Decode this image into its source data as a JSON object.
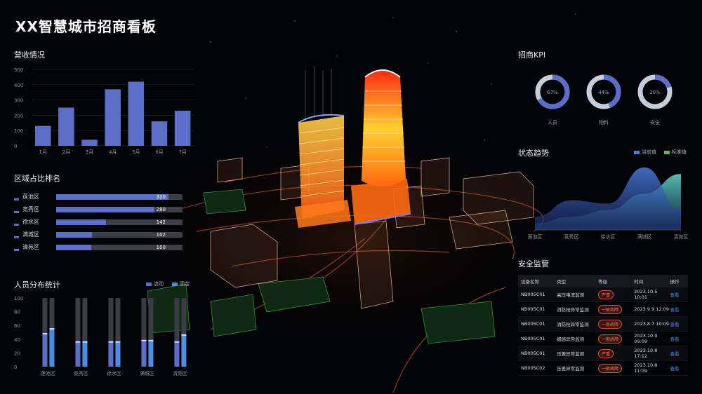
{
  "title": "XX智慧城市招商看板",
  "revenue": {
    "title": "营收情况",
    "yticks": [
      "500",
      "400",
      "300",
      "200",
      "100",
      "0"
    ],
    "chart_data": {
      "type": "bar",
      "categories": [
        "1月",
        "2月",
        "3月",
        "4月",
        "5月",
        "6月",
        "7月"
      ],
      "values": [
        130,
        250,
        40,
        370,
        420,
        160,
        230
      ],
      "ylim": [
        0,
        500
      ],
      "color": "#5b6ec9"
    }
  },
  "district_rank": {
    "title": "区域占比排名",
    "max": 360,
    "items": [
      {
        "name": "莲池区",
        "value": "320",
        "num": 320
      },
      {
        "name": "竞秀区",
        "value": "280",
        "num": 280
      },
      {
        "name": "徐水区",
        "value": "142",
        "num": 142
      },
      {
        "name": "满城区",
        "value": "102",
        "num": 102
      },
      {
        "name": "清苑区",
        "value": "100",
        "num": 100
      }
    ]
  },
  "staff": {
    "title": "人员分布统计",
    "legend": [
      "流动",
      "固定"
    ],
    "yticks": [
      "100",
      "80",
      "60",
      "40",
      "20",
      "0"
    ],
    "chart_data": {
      "type": "bar",
      "categories": [
        "莲池区",
        "竞秀区",
        "徐水区",
        "满城区",
        "清苑区"
      ],
      "series": [
        {
          "name": "流动",
          "values": [
            48,
            36,
            36,
            38,
            36
          ]
        },
        {
          "name": "固定",
          "values": [
            55,
            36,
            36,
            38,
            46
          ]
        }
      ],
      "ylim": [
        0,
        100
      ]
    }
  },
  "kpi": {
    "title": "招商KPI",
    "items": [
      {
        "value": "67%",
        "pct": 0.67,
        "label": "人员"
      },
      {
        "value": "44%",
        "pct": 0.44,
        "label": "物料"
      },
      {
        "value": "20%",
        "pct": 0.2,
        "label": "安全"
      }
    ]
  },
  "trend": {
    "title": "状态趋势",
    "legend": [
      "当前值",
      "标准值"
    ],
    "chart_data": {
      "type": "area",
      "categories": [
        "莲池区",
        "竞秀区",
        "徐水区",
        "满城区",
        "清苑区"
      ],
      "series": [
        {
          "name": "当前值",
          "values": [
            20,
            45,
            40,
            95,
            30
          ]
        },
        {
          "name": "标准值",
          "values": [
            10,
            20,
            30,
            55,
            85
          ]
        }
      ]
    }
  },
  "safety": {
    "title": "安全监管",
    "headers": [
      "设备名称",
      "类型",
      "等级",
      "时间",
      "操作"
    ],
    "rows": [
      {
        "id": "NB005C01",
        "type": "高压电流监测",
        "level": "严重",
        "time": "2023.10.5 10:01",
        "op": "查看"
      },
      {
        "id": "NB005C01",
        "type": "消防栓异常监测",
        "level": "一般故障",
        "time": "2023.9.9 12:09",
        "op": "查看"
      },
      {
        "id": "NB005C01",
        "type": "消防栓异常监测",
        "level": "一般故障",
        "time": "2023.8.7 10:09",
        "op": "查看"
      },
      {
        "id": "NB005C01",
        "type": "烟感异常监测",
        "level": "一般故障",
        "time": "2023.10.9 09:09",
        "op": "查看"
      },
      {
        "id": "NB005C01",
        "type": "压差异常监测",
        "level": "严重",
        "time": "2023.10.8 17:12",
        "op": "查看"
      },
      {
        "id": "NB005C02",
        "type": "压差异常监测",
        "level": "一般故障",
        "time": "2023.10.8 11:09",
        "op": "查看"
      }
    ]
  }
}
